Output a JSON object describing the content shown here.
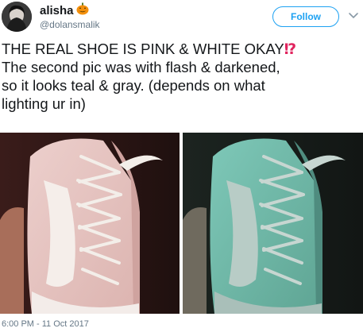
{
  "tweet": {
    "author": {
      "display_name": "alisha",
      "name_emoji": "jack-o-lantern-icon",
      "handle": "@dolansmalik"
    },
    "follow_label": "Follow",
    "text_lines": [
      "THE REAL SHOE IS PINK & WHITE OKAY",
      "The second pic was with flash & darkened,",
      "so it looks teal & gray. (depends on what",
      "lighting ur in)"
    ],
    "text_emoji": "⁉",
    "timestamp": "6:00 PM - 11 Oct 2017"
  },
  "colors": {
    "accent": "#1da1f2",
    "shoe_pink": "#e9c7c4",
    "shoe_teal": "#7fc4b7",
    "emoji_red": "#e0245e"
  }
}
